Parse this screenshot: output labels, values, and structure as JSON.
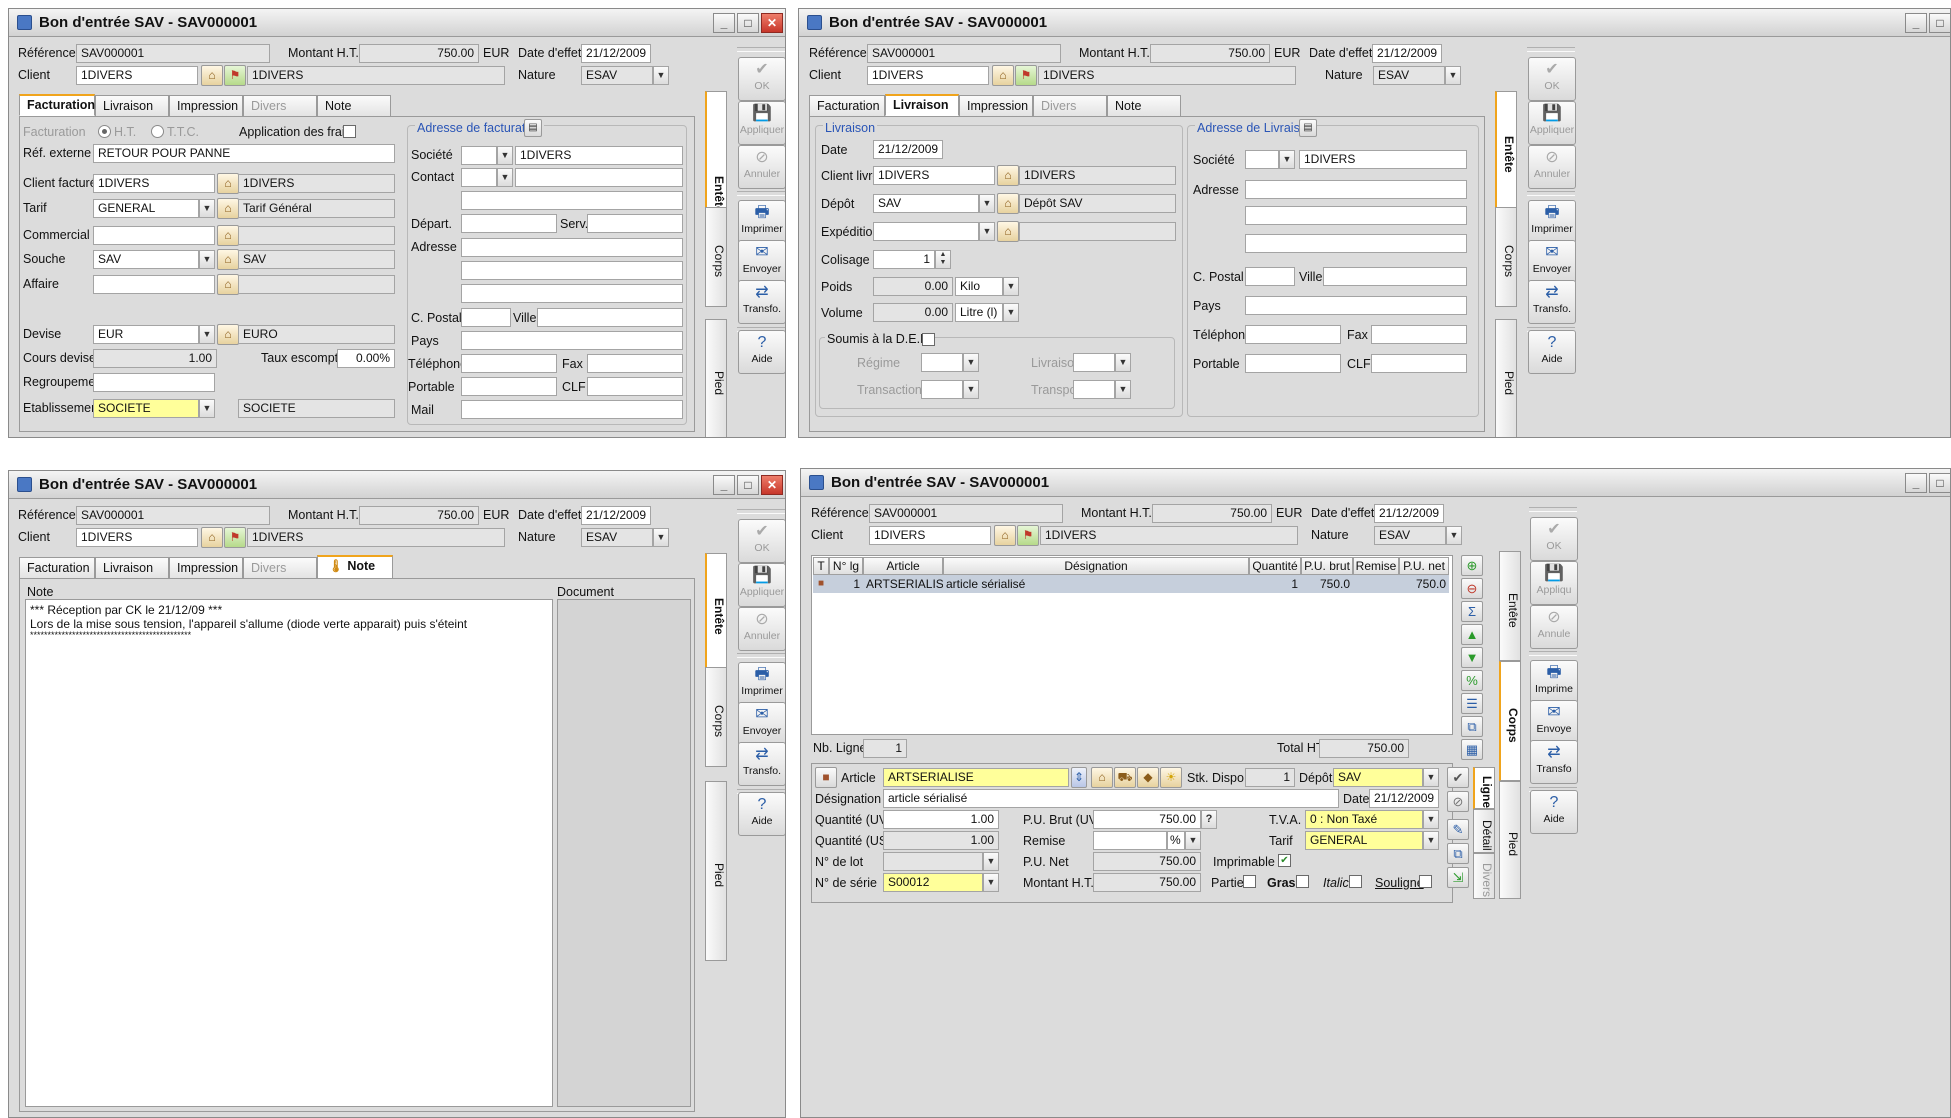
{
  "title": "Bon d'entrée SAV - SAV000001",
  "header": {
    "ref_label": "Référence",
    "ref_value": "SAV000001",
    "montant_label": "Montant H.T.",
    "montant_value": "750.00",
    "currency": "EUR",
    "date_label": "Date d'effet",
    "date_value": "21/12/2009",
    "client_label": "Client",
    "client_code": "1DIVERS",
    "client_name": "1DIVERS",
    "nature_label": "Nature",
    "nature_value": "ESAV"
  },
  "tabs": {
    "facturation": "Facturation",
    "livraison": "Livraison",
    "impression": "Impression",
    "divers": "Divers",
    "note": "Note"
  },
  "side": {
    "ok": "OK",
    "appliquer": "Appliquer",
    "annuler": "Annuler",
    "imprimer": "Imprimer",
    "envoyer": "Envoyer",
    "transfo": "Transfo.",
    "aide": "Aide"
  },
  "side_trunc": {
    "appliquer": "Appliqu",
    "annuler": "Annule",
    "imprimer": "Imprime",
    "envoyer": "Envoye",
    "transfo": "Transfo"
  },
  "vtabs": {
    "entete": "Entête",
    "corps": "Corps",
    "pied": "Pied"
  },
  "fact": {
    "facturation": "Facturation",
    "ht": "H.T.",
    "ttc": "T.T.C.",
    "frais": "Application des frais",
    "ref_externe_label": "Réf. externe",
    "ref_externe": "RETOUR POUR PANNE",
    "client_facture_label": "Client facturé",
    "client_facture": "1DIVERS",
    "client_facture_name": "1DIVERS",
    "tarif_label": "Tarif",
    "tarif": "GENERAL",
    "tarif_name": "Tarif Général",
    "commercial_label": "Commercial",
    "souche_label": "Souche",
    "souche": "SAV",
    "souche_name": "SAV",
    "affaire_label": "Affaire",
    "devise_label": "Devise",
    "devise": "EUR",
    "devise_name": "EURO",
    "cours_label": "Cours devise",
    "cours": "1.00",
    "taux_label": "Taux escompte",
    "taux": "0.00%",
    "regroup_label": "Regroupement",
    "etab_label": "Etablissement",
    "etab": "SOCIETE",
    "etab_name": "SOCIETE",
    "addr_title": "Adresse de facturation",
    "societe_label": "Société",
    "societe": "1DIVERS",
    "contact_label": "Contact",
    "depart_label": "Départ.",
    "serv_label": "Serv.",
    "adresse_label": "Adresse",
    "cpostal_label": "C. Postal",
    "ville_label": "Ville",
    "pays_label": "Pays",
    "tel_label": "Téléphone",
    "fax_label": "Fax",
    "portable_label": "Portable",
    "clf_label": "CLF",
    "mail_label": "Mail"
  },
  "liv": {
    "group_title": "Livraison",
    "date_label": "Date",
    "date": "21/12/2009",
    "client_livre_label": "Client livré",
    "client_livre": "1DIVERS",
    "client_livre_name": "1DIVERS",
    "depot_label": "Dépôt",
    "depot": "SAV",
    "depot_name": "Dépôt SAV",
    "expedition_label": "Expédition",
    "colisage_label": "Colisage",
    "colisage": "1",
    "poids_label": "Poids",
    "poids": "0.00",
    "poids_unit": "Kilo",
    "volume_label": "Volume",
    "volume": "0.00",
    "volume_unit": "Litre (l)",
    "deb_label": "Soumis à la D.E.B.",
    "regime_label": "Régime",
    "livraison_label": "Livraison",
    "transaction_label": "Transaction",
    "transport_label": "Transport",
    "addr_title": "Adresse de Livraison",
    "societe_label": "Société",
    "societe": "1DIVERS",
    "adresse_label": "Adresse",
    "cpostal_label": "C. Postal",
    "ville_label": "Ville",
    "pays_label": "Pays",
    "tel_label": "Téléphone",
    "fax_label": "Fax",
    "portable_label": "Portable",
    "clf_label": "CLF"
  },
  "note": {
    "col_note": "Note",
    "col_doc": "Document",
    "line1": "*** Réception par CK le 21/12/09 ***",
    "line2": "Lors de la mise sous tension, l'appareil s'allume (diode verte apparait) puis s'éteint",
    "line3": "**********************************************"
  },
  "corps": {
    "cols": [
      "T",
      "N° lg",
      "Article",
      "Désignation",
      "Quantité",
      "P.U. brut",
      "Remise",
      "P.U. net"
    ],
    "row": {
      "num": "1",
      "article": "ARTSERIALISE",
      "designation": "article sérialisé",
      "qte": "1",
      "pub": "750.0",
      "remise": "",
      "pun": "750.0"
    },
    "nb_ligne_label": "Nb. Ligne",
    "nb_ligne": "1",
    "total_label": "Total HT",
    "total": "750.00",
    "article_label": "Article",
    "article": "ARTSERIALISE",
    "stk_label": "Stk. Dispo.",
    "stk": "1",
    "depot_label": "Dépôt",
    "depot": "SAV",
    "desig_label": "Désignation",
    "desig": "article sérialisé",
    "date_label": "Date",
    "date": "21/12/2009",
    "quv_label": "Quantité (UV)",
    "quv": "1.00",
    "pubrut_label": "P.U. Brut (UV)",
    "pubrut": "750.00",
    "tva_label": "T.V.A.",
    "tva": "0 : Non Taxé",
    "qus_label": "Quantité (US)",
    "qus": "1.00",
    "remise_label": "Remise",
    "remise_unit": "%",
    "tarif_label": "Tarif",
    "tarif": "GENERAL",
    "lot_label": "N° de lot",
    "punet_label": "P.U. Net",
    "punet": "750.00",
    "imprimable_label": "Imprimable",
    "serie_label": "N° de série",
    "serie": "S00012",
    "mht_label": "Montant H.T.",
    "mht": "750.00",
    "partiel_label": "Partiel",
    "gras_label": "Gras",
    "italic_label": "Italic",
    "souligne_label": "Souligné",
    "vtab_ligne": "Ligne",
    "vtab_detail": "Détail",
    "vtab_divers": "Divers"
  }
}
